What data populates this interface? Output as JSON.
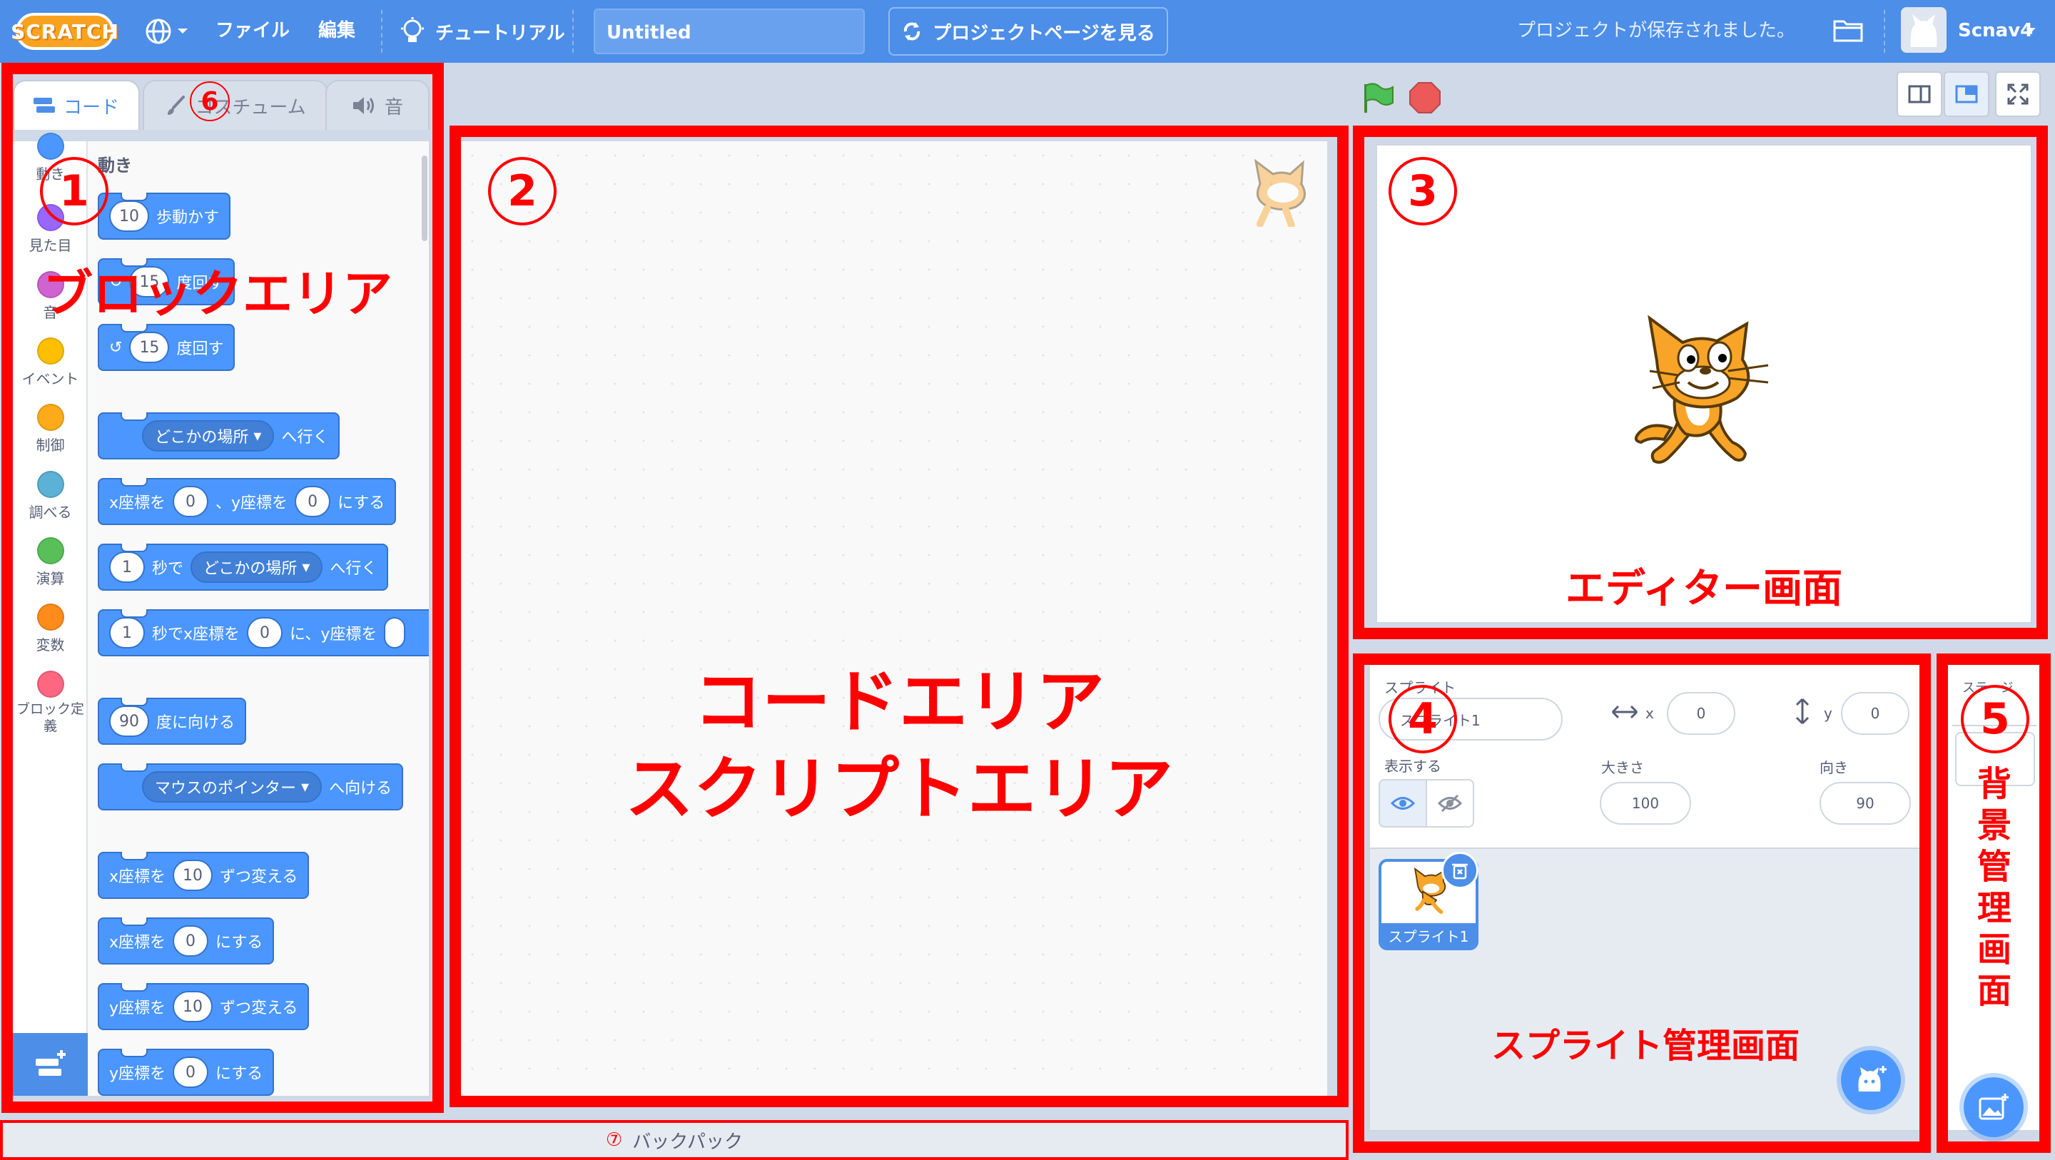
{
  "menubar": {
    "logo": "SCRATCH",
    "file": "ファイル",
    "edit": "編集",
    "tutorials": "チュートリアル",
    "project_title": "Untitled",
    "see_project": "プロジェクトページを見る",
    "saved_status": "プロジェクトが保存されました。",
    "username": "Scnav4"
  },
  "tabs": {
    "code": "コード",
    "costumes": "コスチューム",
    "sounds": "音"
  },
  "categories": [
    {
      "label": "動き",
      "color": "#4c97ff"
    },
    {
      "label": "見た目",
      "color": "#9966ff"
    },
    {
      "label": "音",
      "color": "#cf63cf"
    },
    {
      "label": "イベント",
      "color": "#ffbf00"
    },
    {
      "label": "制御",
      "color": "#ffab19"
    },
    {
      "label": "調べる",
      "color": "#5cb1d6"
    },
    {
      "label": "演算",
      "color": "#59c059"
    },
    {
      "label": "変数",
      "color": "#ff8c1a"
    },
    {
      "label": "ブロック定義",
      "color": "#ff6680"
    }
  ],
  "palette": {
    "heading": "動き",
    "move": {
      "value": "10",
      "text": "歩動かす"
    },
    "turn_right": {
      "value": "15",
      "text": "度回す"
    },
    "turn_left": {
      "value": "15",
      "text": "度回す"
    },
    "goto": {
      "menu": "どこかの場所",
      "text": "へ行く"
    },
    "gotoxy": {
      "a": "x座標を",
      "x": "0",
      "b": "、y座標を",
      "y": "0",
      "c": "にする"
    },
    "glideto": {
      "secs": "1",
      "a": "秒で",
      "menu": "どこかの場所",
      "b": "へ行く"
    },
    "glidexy": {
      "secs": "1",
      "a": "秒でx座標を",
      "x": "0",
      "b": "に、y座標を"
    },
    "point_dir": {
      "value": "90",
      "text": "度に向ける"
    },
    "point_towards": {
      "menu": "マウスのポインター",
      "text": "へ向ける"
    },
    "change_x": {
      "a": "x座標を",
      "value": "10",
      "b": "ずつ変える"
    },
    "set_x": {
      "a": "x座標を",
      "value": "0",
      "b": "にする"
    },
    "change_y": {
      "a": "y座標を",
      "value": "10",
      "b": "ずつ変える"
    },
    "set_y": {
      "a": "y座標を",
      "value": "0",
      "b": "にする"
    }
  },
  "sprite_info": {
    "sprite_label": "スプライト",
    "sprite_name": "スプライト1",
    "x_label": "x",
    "x_value": "0",
    "y_label": "y",
    "y_value": "0",
    "show_label": "表示する",
    "size_label": "大きさ",
    "size_value": "100",
    "direction_label": "向き",
    "direction_value": "90",
    "thumb_name": "スプライト1"
  },
  "stage_pane": {
    "label": "ステージ"
  },
  "backpack": {
    "num": "⑦",
    "label": "バックパック"
  },
  "annotations": {
    "n1": "1",
    "n2": "2",
    "n3": "3",
    "n4": "4",
    "n5": "5",
    "n6": "6",
    "block_area": "ブロックエリア",
    "code_area_1": "コードエリア",
    "code_area_2": "スクリプトエリア",
    "editor": "エディター画面",
    "sprite_mgmt": "スプライト管理画面",
    "bg_mgmt": [
      "背",
      "景",
      "管",
      "理",
      "画",
      "面"
    ]
  },
  "colors": {
    "menubar": "#4c8ee8",
    "motion": "#4c97ff",
    "annotation": "#ff0000"
  }
}
